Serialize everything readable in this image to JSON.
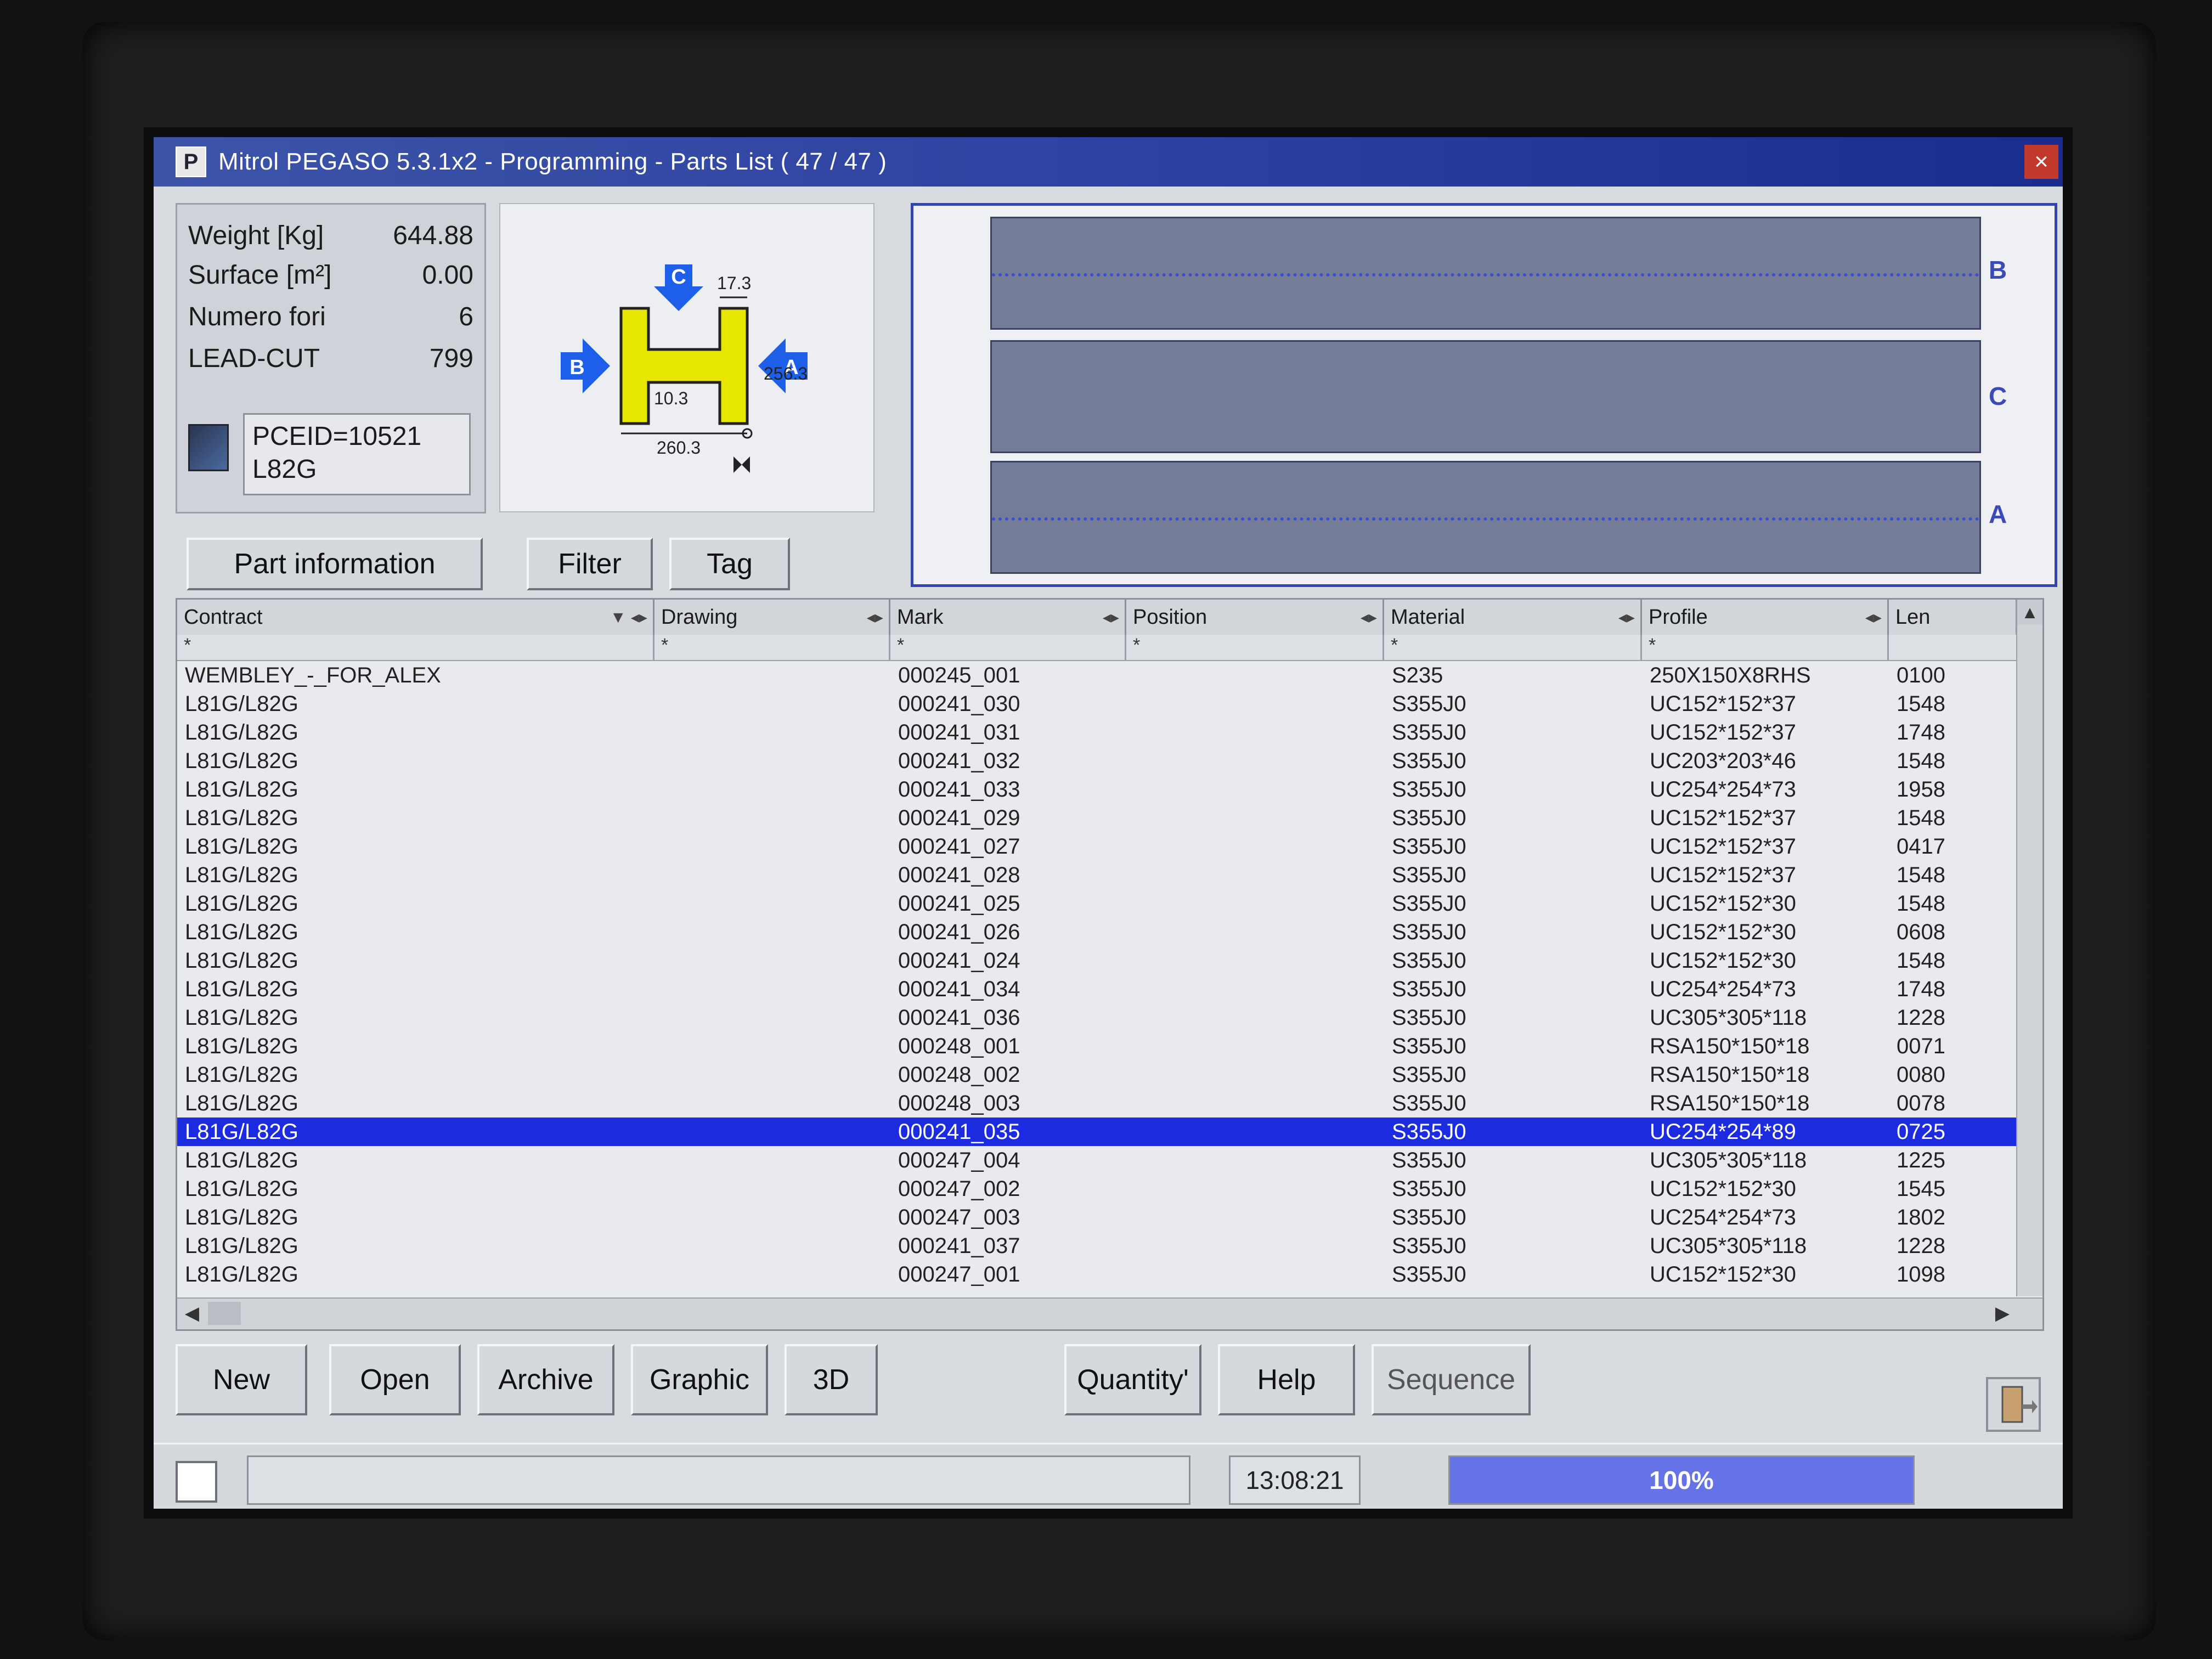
{
  "window": {
    "title": "Mitrol PEGASO 5.3.1x2 - Programming - Parts List ( 47 / 47 )",
    "icon": "P",
    "close_label": "×"
  },
  "info": {
    "rows": [
      {
        "label": "Weight [Kg]",
        "value": "644.88"
      },
      {
        "label": "Surface [m²]",
        "value": "0.00"
      },
      {
        "label": "Numero fori",
        "value": "6"
      },
      {
        "label": "LEAD-CUT",
        "value": "799"
      }
    ],
    "pce_line1": "PCEID=10521",
    "pce_line2": "L82G"
  },
  "section": {
    "face_b": "B",
    "face_c": "C",
    "face_a": "A",
    "flange_thickness": "17.3",
    "web_thickness": "10.3",
    "height": "256.3",
    "width": "260.3",
    "profile_color": "#e6e600",
    "arrow_color": "#1d5fe8"
  },
  "beam_faces": [
    "B",
    "C",
    "A"
  ],
  "toolbar_top": {
    "part_info": "Part information",
    "filter": "Filter",
    "tag": "Tag"
  },
  "grid": {
    "columns": [
      "Contract",
      "Drawing",
      "Mark",
      "Position",
      "Material",
      "Profile",
      "Len"
    ],
    "filter_symbol": "*",
    "rows": [
      {
        "contract": "WEMBLEY_-_FOR_ALEX",
        "mark": "000245_001",
        "material": "S235",
        "profile": "250X150X8RHS",
        "len": "0100"
      },
      {
        "contract": "L81G/L82G",
        "mark": "000241_030",
        "material": "S355J0",
        "profile": "UC152*152*37",
        "len": "1548"
      },
      {
        "contract": "L81G/L82G",
        "mark": "000241_031",
        "material": "S355J0",
        "profile": "UC152*152*37",
        "len": "1748"
      },
      {
        "contract": "L81G/L82G",
        "mark": "000241_032",
        "material": "S355J0",
        "profile": "UC203*203*46",
        "len": "1548"
      },
      {
        "contract": "L81G/L82G",
        "mark": "000241_033",
        "material": "S355J0",
        "profile": "UC254*254*73",
        "len": "1958"
      },
      {
        "contract": "L81G/L82G",
        "mark": "000241_029",
        "material": "S355J0",
        "profile": "UC152*152*37",
        "len": "1548"
      },
      {
        "contract": "L81G/L82G",
        "mark": "000241_027",
        "material": "S355J0",
        "profile": "UC152*152*37",
        "len": "0417"
      },
      {
        "contract": "L81G/L82G",
        "mark": "000241_028",
        "material": "S355J0",
        "profile": "UC152*152*37",
        "len": "1548"
      },
      {
        "contract": "L81G/L82G",
        "mark": "000241_025",
        "material": "S355J0",
        "profile": "UC152*152*30",
        "len": "1548"
      },
      {
        "contract": "L81G/L82G",
        "mark": "000241_026",
        "material": "S355J0",
        "profile": "UC152*152*30",
        "len": "0608"
      },
      {
        "contract": "L81G/L82G",
        "mark": "000241_024",
        "material": "S355J0",
        "profile": "UC152*152*30",
        "len": "1548"
      },
      {
        "contract": "L81G/L82G",
        "mark": "000241_034",
        "material": "S355J0",
        "profile": "UC254*254*73",
        "len": "1748"
      },
      {
        "contract": "L81G/L82G",
        "mark": "000241_036",
        "material": "S355J0",
        "profile": "UC305*305*118",
        "len": "1228"
      },
      {
        "contract": "L81G/L82G",
        "mark": "000248_001",
        "material": "S355J0",
        "profile": "RSA150*150*18",
        "len": "0071"
      },
      {
        "contract": "L81G/L82G",
        "mark": "000248_002",
        "material": "S355J0",
        "profile": "RSA150*150*18",
        "len": "0080"
      },
      {
        "contract": "L81G/L82G",
        "mark": "000248_003",
        "material": "S355J0",
        "profile": "RSA150*150*18",
        "len": "0078"
      },
      {
        "contract": "L81G/L82G",
        "mark": "000241_035",
        "material": "S355J0",
        "profile": "UC254*254*89",
        "len": "0725",
        "selected": true
      },
      {
        "contract": "L81G/L82G",
        "mark": "000247_004",
        "material": "S355J0",
        "profile": "UC305*305*118",
        "len": "1225"
      },
      {
        "contract": "L81G/L82G",
        "mark": "000247_002",
        "material": "S355J0",
        "profile": "UC152*152*30",
        "len": "1545"
      },
      {
        "contract": "L81G/L82G",
        "mark": "000247_003",
        "material": "S355J0",
        "profile": "UC254*254*73",
        "len": "1802"
      },
      {
        "contract": "L81G/L82G",
        "mark": "000241_037",
        "material": "S355J0",
        "profile": "UC305*305*118",
        "len": "1228"
      },
      {
        "contract": "L81G/L82G",
        "mark": "000247_001",
        "material": "S355J0",
        "profile": "UC152*152*30",
        "len": "1098"
      }
    ]
  },
  "toolbar_bottom": {
    "new": "New",
    "open": "Open",
    "archive": "Archive",
    "graphic": "Graphic",
    "three_d": "3D",
    "quantity": "Quantity'",
    "help": "Help",
    "sequence": "Sequence"
  },
  "status": {
    "time": "13:08:21",
    "progress_label": "100%",
    "progress_value": 1.0
  }
}
